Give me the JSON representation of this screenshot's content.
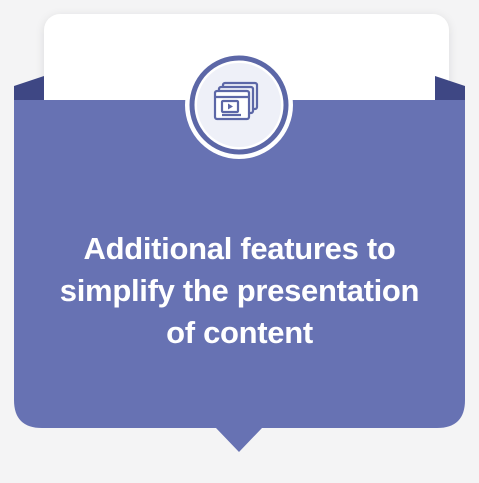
{
  "card": {
    "title_lines": [
      "Additional features to",
      "simplify the presentation",
      "of content"
    ]
  },
  "icon": {
    "name": "video-presentation-icon"
  },
  "colors": {
    "background": "#f4f4f5",
    "card_white": "#ffffff",
    "pocket": "#6772b3",
    "pocket_dark": "#3e4784",
    "badge_ring": "#5c67a7",
    "badge_inner": "#eef0f8",
    "icon_stroke": "#5c67a7"
  }
}
